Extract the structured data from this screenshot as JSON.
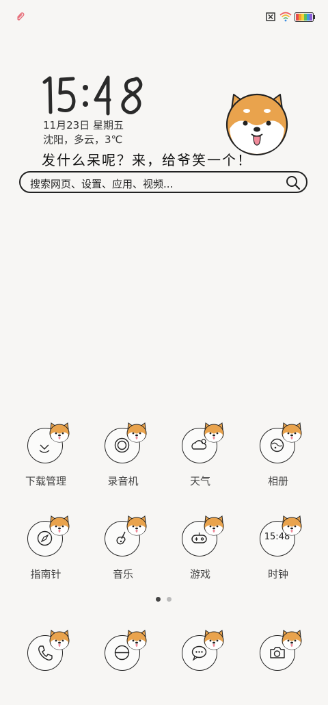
{
  "status_bar": {
    "left_icon": "paperclip-icon",
    "right_icons": [
      "sim-off-icon",
      "wifi-icon",
      "battery-icon"
    ]
  },
  "widget": {
    "time": "15:48",
    "date": "11月23日 星期五",
    "weather": "沈阳，多云，3℃",
    "slogan": "发什么呆呢？来，给爷笑一个！",
    "mascot": "shiba-dog-face"
  },
  "search": {
    "placeholder": "搜索网页、设置、应用、视频..."
  },
  "apps": [
    {
      "label": "下载管理",
      "icon": "download-icon"
    },
    {
      "label": "录音机",
      "icon": "recorder-icon"
    },
    {
      "label": "天气",
      "icon": "weather-icon"
    },
    {
      "label": "相册",
      "icon": "gallery-icon"
    },
    {
      "label": "指南针",
      "icon": "compass-icon"
    },
    {
      "label": "音乐",
      "icon": "guitar-icon"
    },
    {
      "label": "游戏",
      "icon": "gamepad-icon"
    },
    {
      "label": "时钟",
      "icon": "clock-icon",
      "text": "15:48"
    }
  ],
  "dock": [
    {
      "icon": "phone-icon"
    },
    {
      "icon": "browser-icon"
    },
    {
      "icon": "messages-icon"
    },
    {
      "icon": "camera-icon"
    }
  ],
  "pager": {
    "pages": 2,
    "current": 1
  },
  "colors": {
    "background": "#f7f6f4",
    "dog_orange": "#e9a34d",
    "line": "#222222"
  }
}
